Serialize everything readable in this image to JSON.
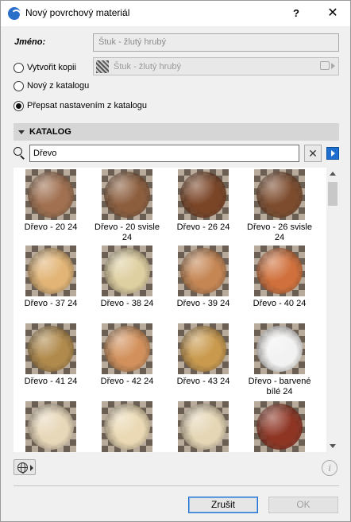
{
  "window": {
    "title": "Nový povrchový materiál",
    "help_label": "?",
    "close_label": "✕"
  },
  "name_row": {
    "label": "Jméno:",
    "value": "Štuk - žlutý hrubý"
  },
  "options": [
    {
      "label": "Vytvořit kopii",
      "checked": false
    },
    {
      "label": "Nový z katalogu",
      "checked": false
    },
    {
      "label": "Přepsat nastavením z katalogu",
      "checked": true
    }
  ],
  "copy_source": {
    "value": "Štuk - žlutý hrubý",
    "disabled": true
  },
  "catalog": {
    "header": "KATALOG",
    "search_value": "Dřevo",
    "clear_label": "✕"
  },
  "materials": [
    {
      "label": "Dřevo - 20 24",
      "color": "#a07050"
    },
    {
      "label": "Dřevo - 20 svisle 24",
      "color": "#8c5e3e"
    },
    {
      "label": "Dřevo - 26 24",
      "color": "#7a4426"
    },
    {
      "label": "Dřevo - 26 svisle 24",
      "color": "#7d4c2e"
    },
    {
      "label": "Dřevo - 37 24",
      "color": "#e2b577"
    },
    {
      "label": "Dřevo - 38 24",
      "color": "#dfd0a2"
    },
    {
      "label": "Dřevo - 39 24",
      "color": "#c58654"
    },
    {
      "label": "Dřevo - 40 24",
      "color": "#d0703c"
    },
    {
      "label": "Dřevo - 41 24",
      "color": "#b08a4c"
    },
    {
      "label": "Dřevo - 42 24",
      "color": "#d2915c"
    },
    {
      "label": "Dřevo - 43 24",
      "color": "#c99a4e"
    },
    {
      "label": "Dřevo - barvené bílé 24",
      "color": "#f2f2f2"
    },
    {
      "label": "",
      "color": "#e8d8ba"
    },
    {
      "label": "",
      "color": "#ead9b4"
    },
    {
      "label": "",
      "color": "#e5d6b6"
    },
    {
      "label": "",
      "color": "#8e3524"
    }
  ],
  "footer": {
    "info_label": "i",
    "cancel_label": "Zrušit",
    "ok_label": "OK"
  }
}
